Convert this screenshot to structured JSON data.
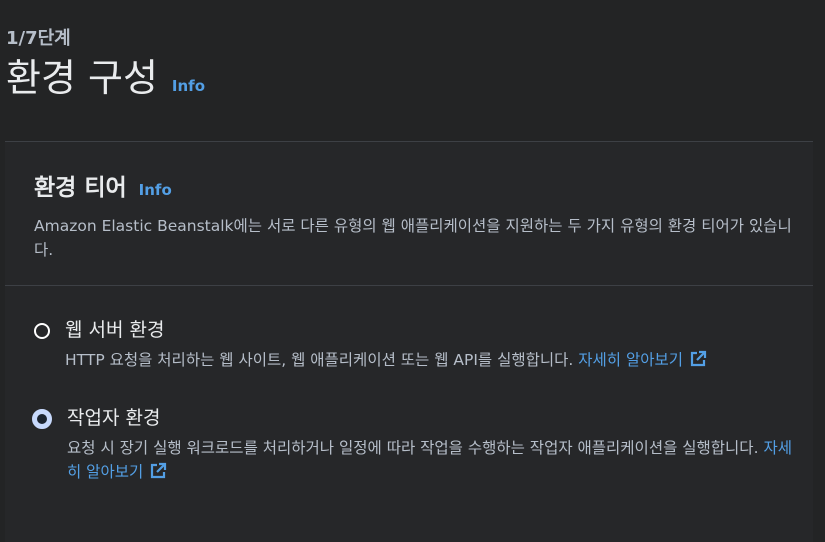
{
  "step": {
    "label": "1/7단계"
  },
  "page": {
    "title": "환경 구성",
    "info_label": "Info"
  },
  "panel": {
    "title": "환경 티어",
    "info_label": "Info",
    "description": "Amazon Elastic Beanstalk에는 서로 다른 유형의 웹 애플리케이션을 지원하는 두 가지 유형의 환경 티어가 있습니다."
  },
  "tiers": [
    {
      "title": "웹 서버 환경",
      "description": "HTTP 요청을 처리하는 웹 사이트, 웹 애플리케이션 또는 웹 API를 실행합니다.",
      "learn_more": "자세히 알아보기",
      "selected": false
    },
    {
      "title": "작업자 환경",
      "description": "요청 시 장기 실행 워크로드를 처리하거나 일정에 따라 작업을 수행하는 작업자 애플리케이션을 실행합니다.",
      "learn_more": "자세히 알아보기",
      "selected": true
    }
  ],
  "colors": {
    "background": "#232425",
    "panel": "#262729",
    "link": "#539fe5",
    "radio_selected": "#c7d9fc"
  },
  "icons": {
    "external_link": "external-link-icon"
  }
}
